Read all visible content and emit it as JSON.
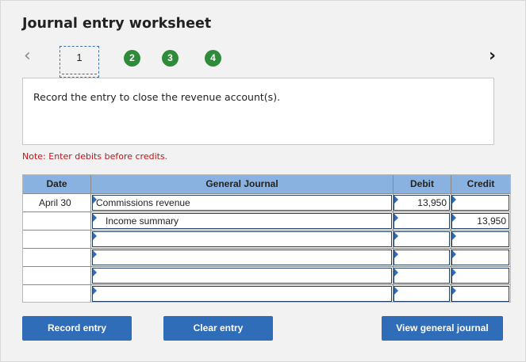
{
  "title": "Journal entry worksheet",
  "nav": {
    "prev_icon": "chevron-left-icon",
    "next_icon": "chevron-right-icon"
  },
  "steps": [
    {
      "label": "1",
      "current": true
    },
    {
      "label": "2",
      "complete": true
    },
    {
      "label": "3",
      "complete": true
    },
    {
      "label": "4",
      "complete": true
    }
  ],
  "instruction": "Record the entry to close the revenue account(s).",
  "note": "Note: Enter debits before credits.",
  "table": {
    "headers": {
      "date": "Date",
      "account": "General Journal",
      "debit": "Debit",
      "credit": "Credit"
    },
    "rows": [
      {
        "date": "April 30",
        "account": "Commissions revenue",
        "debit": "13,950",
        "credit": ""
      },
      {
        "date": "",
        "account": "Income summary",
        "debit": "",
        "credit": "13,950"
      },
      {
        "date": "",
        "account": "",
        "debit": "",
        "credit": ""
      },
      {
        "date": "",
        "account": "",
        "debit": "",
        "credit": ""
      },
      {
        "date": "",
        "account": "",
        "debit": "",
        "credit": ""
      },
      {
        "date": "",
        "account": "",
        "debit": "",
        "credit": ""
      }
    ]
  },
  "buttons": {
    "record": "Record entry",
    "clear": "Clear entry",
    "view": "View general journal"
  },
  "colors": {
    "accent": "#2f6db8",
    "header": "#8ab2e0",
    "step": "#2e8b3a",
    "note": "#c0141b"
  }
}
